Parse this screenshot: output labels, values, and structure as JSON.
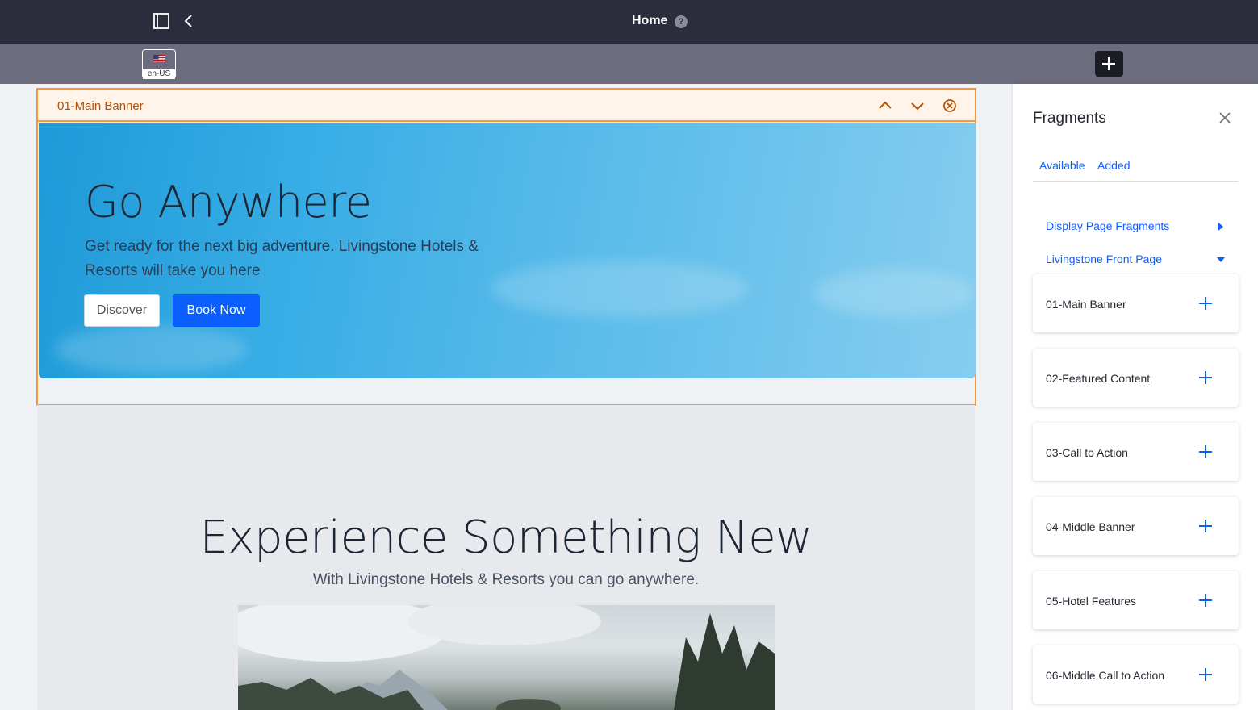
{
  "topbar": {
    "title": "Home",
    "help_symbol": "?"
  },
  "subbar": {
    "locale": "en-US"
  },
  "fragment_editor": {
    "fragment_name": "01-Main Banner"
  },
  "banner": {
    "heading": "Go Anywhere",
    "text": "Get ready for the next big adventure. Livingstone Hotels & Resorts will take you here",
    "discover_label": "Discover",
    "book_label": "Book Now"
  },
  "section2": {
    "heading": "Experience Something New",
    "subtitle": "With Livingstone Hotels & Resorts you can go anywhere."
  },
  "sidebar": {
    "title": "Fragments",
    "tabs": [
      "Available",
      "Added"
    ],
    "collections": [
      "Display Page Fragments",
      "Livingstone Front Page"
    ],
    "fragments": [
      "01-Main Banner",
      "02-Featured Content",
      "03-Call to Action",
      "04-Middle Banner",
      "05-Hotel Features",
      "06-Middle Call to Action"
    ]
  },
  "colors": {
    "accent": "#0b5fff",
    "topbar": "#2c2d3c",
    "subbar": "#6b6c7e",
    "highlight": "#f39740"
  }
}
